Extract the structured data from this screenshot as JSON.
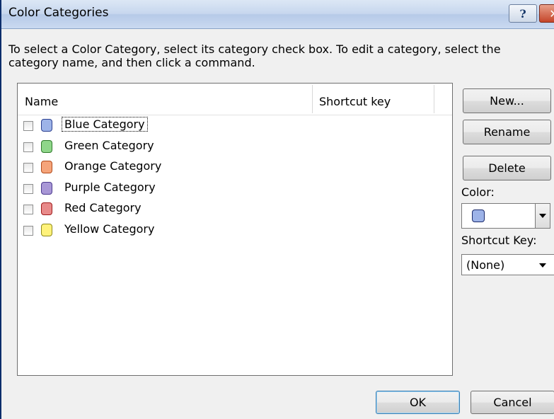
{
  "window": {
    "title": "Color Categories",
    "help_label": "?",
    "close_label": "✕"
  },
  "instructions": "To select a Color Category, select its category check box.  To edit a category, select the category name, and then click a command.",
  "list": {
    "columns": [
      "Name",
      "Shortcut key"
    ],
    "rows": [
      {
        "name": "Blue Category",
        "color": "#9db3e8",
        "border": "#2b3f8f",
        "shortcut": "",
        "checked": false,
        "focused": true
      },
      {
        "name": "Green Category",
        "color": "#8fd68a",
        "border": "#2e7a2a",
        "shortcut": "",
        "checked": false,
        "focused": false
      },
      {
        "name": "Orange Category",
        "color": "#f5a47a",
        "border": "#b24a1a",
        "shortcut": "",
        "checked": false,
        "focused": false
      },
      {
        "name": "Purple Category",
        "color": "#a897d6",
        "border": "#4b3a8f",
        "shortcut": "",
        "checked": false,
        "focused": false
      },
      {
        "name": "Red Category",
        "color": "#e88a8a",
        "border": "#9f1a1a",
        "shortcut": "",
        "checked": false,
        "focused": false
      },
      {
        "name": "Yellow Category",
        "color": "#fff27a",
        "border": "#8f8a1a",
        "shortcut": "",
        "checked": false,
        "focused": false
      }
    ]
  },
  "commands": {
    "new_label": "New...",
    "rename_label": "Rename",
    "delete_label": "Delete"
  },
  "color_field": {
    "label": "Color:",
    "selected_color": "#9db3e8",
    "selected_icon": "color-swatch-icon"
  },
  "shortcut_field": {
    "label": "Shortcut Key:",
    "value": "(None)"
  },
  "footer": {
    "ok_label": "OK",
    "cancel_label": "Cancel"
  }
}
